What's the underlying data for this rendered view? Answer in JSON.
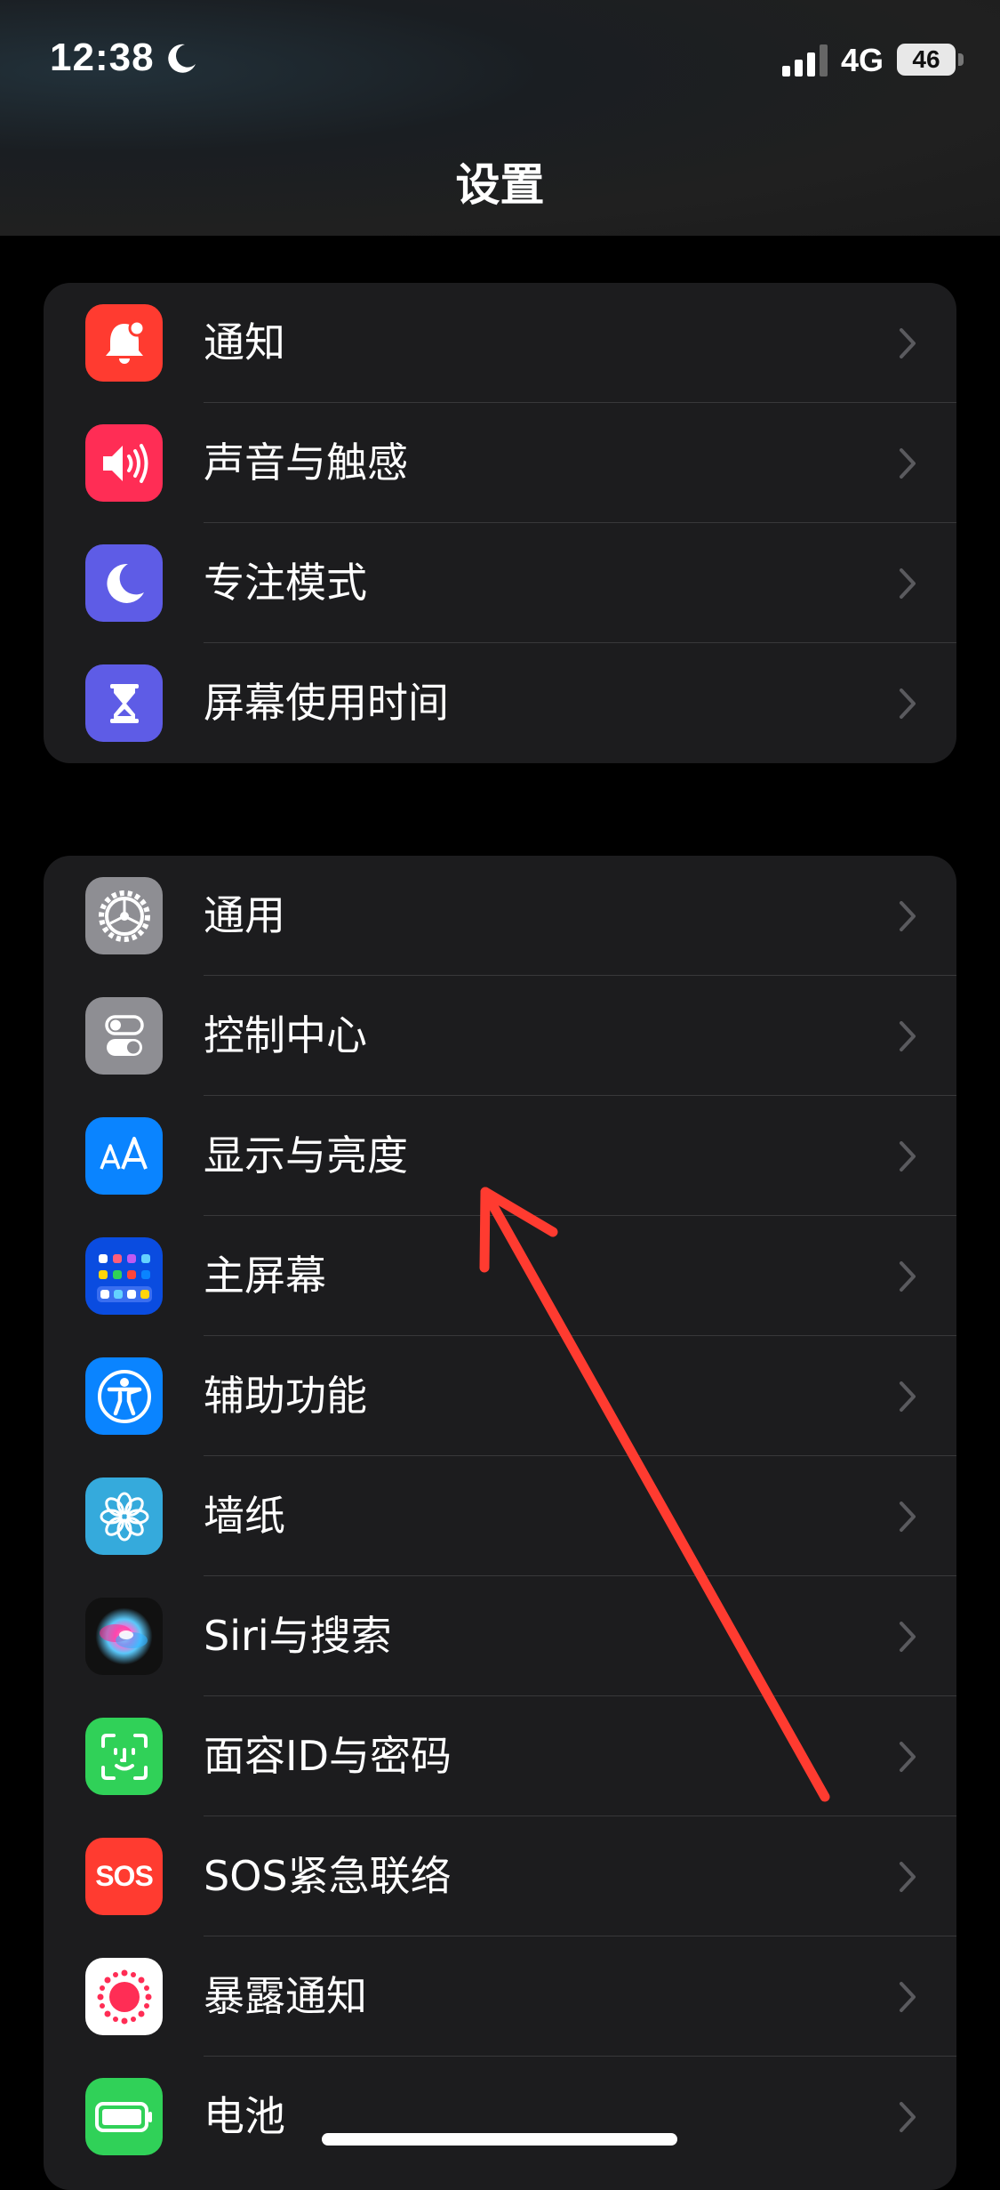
{
  "status": {
    "time": "12:38",
    "network": "4G",
    "battery": "46"
  },
  "header": {
    "title": "设置"
  },
  "groups": [
    {
      "items": [
        {
          "label": "通知",
          "icon": "notifications-icon",
          "color": "#ff3b30"
        },
        {
          "label": "声音与触感",
          "icon": "sounds-icon",
          "color": "#ff2d55"
        },
        {
          "label": "专注模式",
          "icon": "focus-icon",
          "color": "#5e5ce6"
        },
        {
          "label": "屏幕使用时间",
          "icon": "screen-time-icon",
          "color": "#5e5ce6"
        }
      ]
    },
    {
      "items": [
        {
          "label": "通用",
          "icon": "general-gear-icon",
          "color": "#8e8e93"
        },
        {
          "label": "控制中心",
          "icon": "control-center-icon",
          "color": "#8e8e93"
        },
        {
          "label": "显示与亮度",
          "icon": "display-brightness-icon",
          "color": "#0a84ff"
        },
        {
          "label": "主屏幕",
          "icon": "home-screen-icon",
          "color": "#0a4ce0"
        },
        {
          "label": "辅助功能",
          "icon": "accessibility-icon",
          "color": "#0a84ff"
        },
        {
          "label": "墙纸",
          "icon": "wallpaper-icon",
          "color": "#35aadc"
        },
        {
          "label": "Siri与搜索",
          "icon": "siri-icon",
          "color": "#1c1c1e"
        },
        {
          "label": "面容ID与密码",
          "icon": "face-id-icon",
          "color": "#30d158"
        },
        {
          "label": "SOS紧急联络",
          "icon": "sos-icon",
          "color": "#ff3b30",
          "icon_text": "SOS"
        },
        {
          "label": "暴露通知",
          "icon": "exposure-notification-icon",
          "color": "#ffffff"
        },
        {
          "label": "电池",
          "icon": "battery-icon",
          "color": "#30d158"
        }
      ]
    }
  ],
  "annotation": {
    "color": "#ff3b30"
  }
}
